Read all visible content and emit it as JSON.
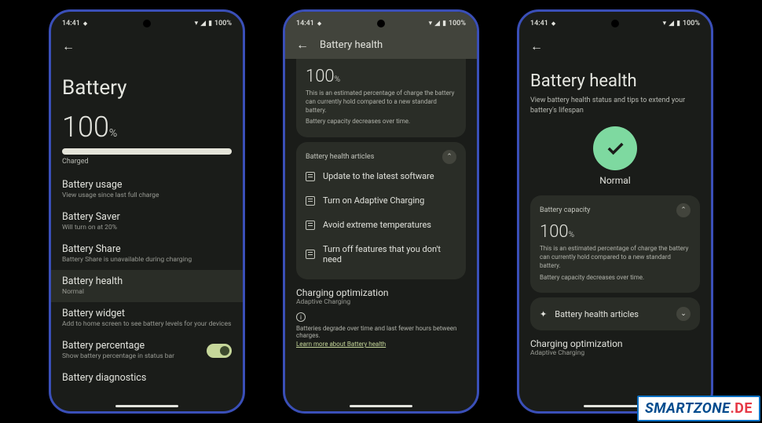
{
  "statusbar": {
    "time": "14:41",
    "battery_text": "100%"
  },
  "phone1": {
    "title": "Battery",
    "percent": "100",
    "percent_unit": "%",
    "charged_label": "Charged",
    "rows": [
      {
        "title": "Battery usage",
        "desc": "View usage since last full charge"
      },
      {
        "title": "Battery Saver",
        "desc": "Will turn on at 20%"
      },
      {
        "title": "Battery Share",
        "desc": "Battery Share is unavailable during charging"
      },
      {
        "title": "Battery health",
        "desc": "Normal"
      },
      {
        "title": "Battery widget",
        "desc": "Add to home screen to see battery levels for your devices"
      },
      {
        "title": "Battery percentage",
        "desc": "Show battery percentage in status bar"
      },
      {
        "title": "Battery diagnostics",
        "desc": ""
      }
    ]
  },
  "phone2": {
    "header": "Battery health",
    "capacity_pct": "100",
    "capacity_unit": "%",
    "capacity_desc": "This is an estimated percentage of charge the battery can currently hold compared to a new standard battery.",
    "capacity_note": "Battery capacity decreases over time.",
    "articles_header": "Battery health articles",
    "articles": [
      "Update to the latest software",
      "Turn on Adaptive Charging",
      "Avoid extreme temperatures",
      "Turn off features that you don't need"
    ],
    "charging_opt": "Charging optimization",
    "charging_opt_sub": "Adaptive Charging",
    "footer_text": "Batteries degrade over time and last fewer hours between charges.",
    "footer_link": "Learn more about Battery health"
  },
  "phone3": {
    "title": "Battery health",
    "subtitle": "View battery health status and tips to extend your battery's lifespan",
    "status": "Normal",
    "capacity_label": "Battery capacity",
    "capacity_pct": "100",
    "capacity_unit": "%",
    "capacity_desc": "This is an estimated percentage of charge the battery can currently hold compared to a new standard battery.",
    "capacity_note": "Battery capacity decreases over time.",
    "articles_label": "Battery health articles",
    "charging_opt": "Charging optimization",
    "charging_opt_sub": "Adaptive Charging"
  },
  "watermark": {
    "brand": "SMARTZONE",
    "tld": ".DE"
  }
}
